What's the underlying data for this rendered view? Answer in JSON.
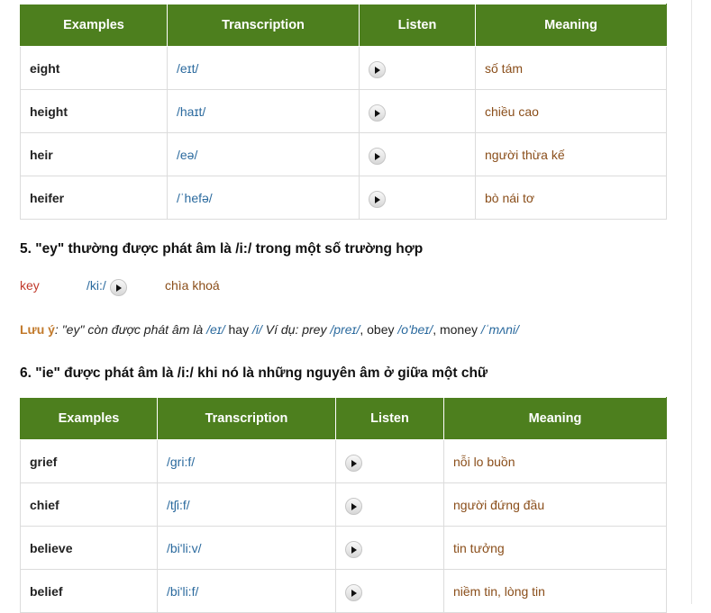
{
  "table1": {
    "headers": [
      "Examples",
      "Transcription",
      "Listen",
      "Meaning"
    ],
    "rows": [
      {
        "word": "eight",
        "ipa": "/eɪt/",
        "meaning": " số tám"
      },
      {
        "word": "height",
        "ipa": "/haɪt/",
        "meaning": " chiều cao"
      },
      {
        "word": "heir",
        "ipa": "/eə/",
        "meaning": "người thừa kế"
      },
      {
        "word": "heifer",
        "ipa": "/ˈhefə/",
        "meaning": "bò nái tơ"
      }
    ]
  },
  "section5": {
    "heading": "5. \"ey\" thường được phát âm là /i:/ trong một số trường hợp",
    "example": {
      "word": "key",
      "ipa": "/ki:/",
      "meaning": "chìa khoá"
    },
    "note": {
      "label": "Lưu ý",
      "colon": ": ",
      "t1": "\"ey\" còn được phát âm là ",
      "i1": "/eɪ/",
      "t2": " hay ",
      "i2": "/i/",
      "t3": " Ví dụ: prey ",
      "i3": "/preɪ/",
      "t4": ", obey ",
      "i4": "/o'beɪ/",
      "t5": ", money ",
      "i5": "/ˈmʌni/"
    }
  },
  "section6": {
    "heading": "6. \"ie\" được phát âm là /i:/ khi nó là những nguyên âm ở giữa một chữ"
  },
  "table2": {
    "headers": [
      "Examples",
      "Transcription",
      "Listen",
      "Meaning"
    ],
    "rows": [
      {
        "word": "grief",
        "ipa": "/gri:f/",
        "meaning": "nỗi lo buồn"
      },
      {
        "word": "chief",
        "ipa": "/tʃi:f/",
        "meaning": " người đứng đầu"
      },
      {
        "word": "believe",
        "ipa": "/bi'li:v/",
        "meaning": "tin tưởng"
      },
      {
        "word": "belief",
        "ipa": "/bi'li:f/",
        "meaning": "niềm tin, lòng tin"
      }
    ]
  },
  "colors": {
    "header_green": "#4d7f1e",
    "ipa_blue": "#2b6a9e",
    "meaning_brown": "#8a4e1a",
    "key_red": "#c0392b"
  },
  "icons": {
    "play": "play-icon"
  }
}
